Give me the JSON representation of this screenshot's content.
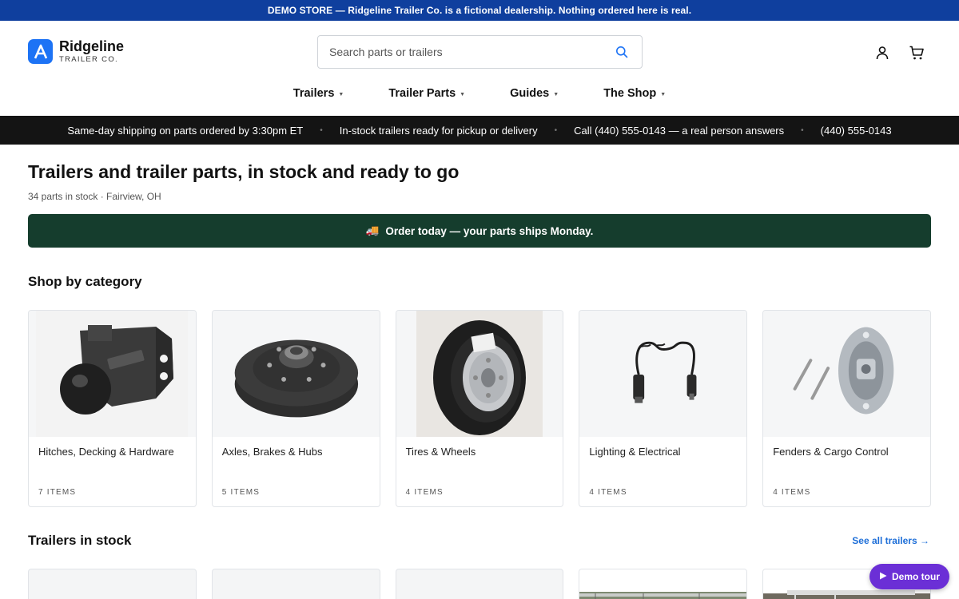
{
  "demo_bar": {
    "text": "DEMO STORE — Ridgeline Trailer Co. is a fictional dealership. Nothing ordered here is real."
  },
  "header": {
    "logo_name": "Ridgeline",
    "logo_sub": "TRAILER CO.",
    "search_placeholder": "Search parts or trailers",
    "search_value": ""
  },
  "nav": {
    "items": [
      {
        "label": "Trailers"
      },
      {
        "label": "Trailer Parts"
      },
      {
        "label": "Guides"
      },
      {
        "label": "The Shop"
      }
    ]
  },
  "ticker": {
    "items": [
      "Same-day shipping on parts ordered by 3:30pm ET",
      "In-stock trailers ready for pickup or delivery",
      "Call (440) 555-0143 — a real person answers",
      "(440) 555-0143"
    ]
  },
  "main": {
    "title": "Trailers and trailer parts, in stock and ready to go",
    "subtitle": "34 parts in stock · Fairview, OH",
    "order_banner": "Order today — your parts ships Monday.",
    "order_icon": "🚚"
  },
  "categories": {
    "title": "Shop by category",
    "items": [
      {
        "name": "Hitches, Decking & Hardware",
        "count": "7 ITEMS"
      },
      {
        "name": "Axles, Brakes & Hubs",
        "count": "5 ITEMS"
      },
      {
        "name": "Tires & Wheels",
        "count": "4 ITEMS"
      },
      {
        "name": "Lighting & Electrical",
        "count": "4 ITEMS"
      },
      {
        "name": "Fenders & Cargo Control",
        "count": "4 ITEMS"
      }
    ]
  },
  "trailers": {
    "title": "Trailers in stock",
    "see_all": "See all trailers →"
  },
  "demo_tour": {
    "label": "Demo tour"
  },
  "colors": {
    "demo_bar": "#0f3f9e",
    "accent_blue": "#1d73f5",
    "ticker_bg": "#141414",
    "order_banner": "#153d2d",
    "demo_tour": "#6b2fd6",
    "link": "#1d6ed8"
  }
}
